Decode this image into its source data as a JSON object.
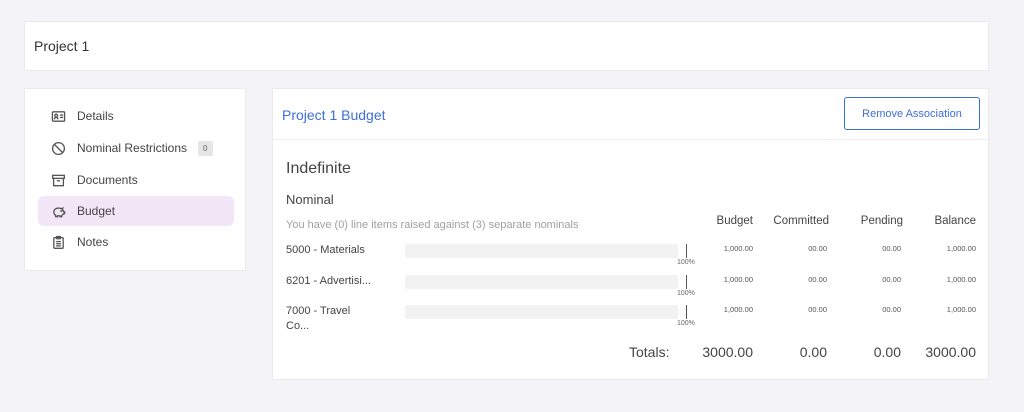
{
  "header": {
    "title": "Project 1"
  },
  "sidebar": {
    "items": [
      {
        "label": "Details",
        "icon": "id-card-icon"
      },
      {
        "label": "Nominal Restrictions",
        "icon": "ban-icon",
        "badge": "0"
      },
      {
        "label": "Documents",
        "icon": "archive-box-icon"
      },
      {
        "label": "Budget",
        "icon": "piggy-bank-icon",
        "active": true
      },
      {
        "label": "Notes",
        "icon": "clipboard-icon"
      }
    ]
  },
  "budget": {
    "title": "Project 1 Budget",
    "remove_label": "Remove Association",
    "period": "Indefinite",
    "section": "Nominal",
    "summary": "You have (0) line items raised against (3) separate nominals",
    "columns": [
      "Budget",
      "Committed",
      "Pending",
      "Balance"
    ],
    "rows": [
      {
        "name": "5000 - Materials",
        "percent": "100%",
        "budget": "1,000.00",
        "committed": "00.00",
        "pending": "00.00",
        "balance": "1,000.00"
      },
      {
        "name": "6201 - Advertisi...",
        "percent": "100%",
        "budget": "1,000.00",
        "committed": "00.00",
        "pending": "00.00",
        "balance": "1,000.00"
      },
      {
        "name": "7000 - Travel Co...",
        "percent": "100%",
        "budget": "1,000.00",
        "committed": "00.00",
        "pending": "00.00",
        "balance": "1,000.00"
      }
    ],
    "totals": {
      "label": "Totals:",
      "budget": "3000.00",
      "committed": "0.00",
      "pending": "0.00",
      "balance": "3000.00"
    }
  },
  "colors": {
    "accent": "#3b6fd8",
    "active_bg": "#f3e6f7"
  }
}
